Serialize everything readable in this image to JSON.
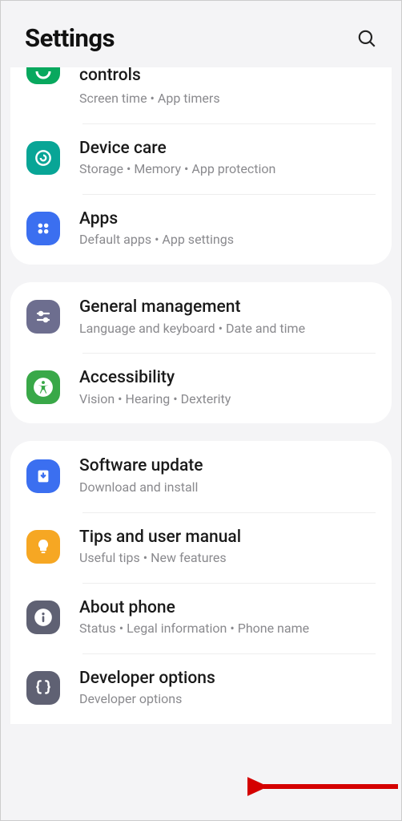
{
  "header": {
    "title": "Settings"
  },
  "groups": [
    {
      "items": [
        {
          "name": "digital-wellbeing",
          "icon": "wellbeing-icon",
          "icon_bg": "bg-green-dark",
          "title_cut": "controls",
          "subtitle": "Screen time  •  App timers",
          "cutoff": true
        },
        {
          "name": "device-care",
          "icon": "device-care-icon",
          "icon_bg": "bg-teal",
          "title": "Device care",
          "subtitle": "Storage  •  Memory  •  App protection"
        },
        {
          "name": "apps",
          "icon": "apps-icon",
          "icon_bg": "bg-blue",
          "title": "Apps",
          "subtitle": "Default apps  •  App settings"
        }
      ]
    },
    {
      "items": [
        {
          "name": "general-management",
          "icon": "sliders-icon",
          "icon_bg": "bg-purple-grey",
          "title": "General management",
          "subtitle": "Language and keyboard  •  Date and time"
        },
        {
          "name": "accessibility",
          "icon": "accessibility-icon",
          "icon_bg": "bg-green",
          "title": "Accessibility",
          "subtitle": "Vision  •  Hearing  •  Dexterity"
        }
      ]
    },
    {
      "items": [
        {
          "name": "software-update",
          "icon": "download-icon",
          "icon_bg": "bg-blue",
          "title": "Software update",
          "subtitle": "Download and install"
        },
        {
          "name": "tips-manual",
          "icon": "bulb-icon",
          "icon_bg": "bg-orange",
          "title": "Tips and user manual",
          "subtitle": "Useful tips  •  New features"
        },
        {
          "name": "about-phone",
          "icon": "info-icon",
          "icon_bg": "bg-grey",
          "title": "About phone",
          "subtitle": "Status  •  Legal information  •  Phone name"
        },
        {
          "name": "developer-options",
          "icon": "braces-icon",
          "icon_bg": "bg-grey",
          "title": "Developer options",
          "subtitle": "Developer options"
        }
      ]
    }
  ]
}
